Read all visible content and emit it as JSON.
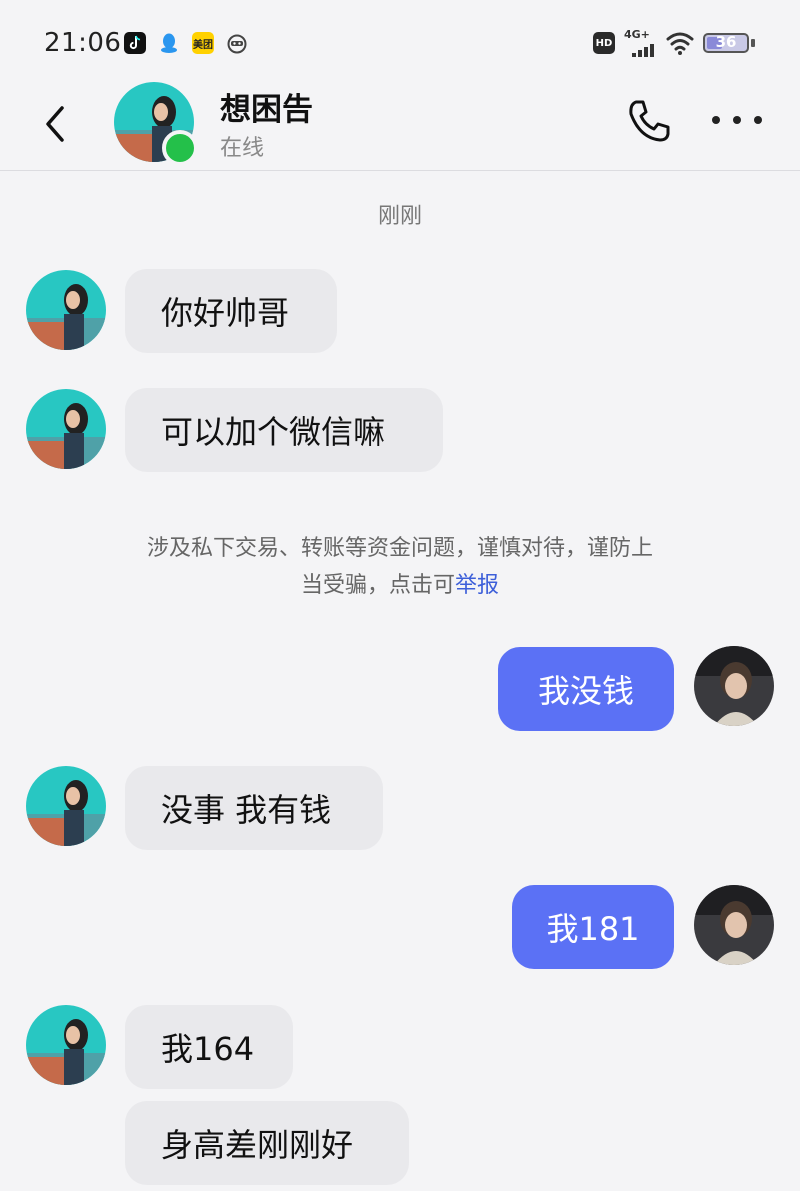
{
  "status_bar": {
    "time": "21:06",
    "apps": [
      {
        "icon": "douyin-icon",
        "color": "#111111"
      },
      {
        "icon": "qq-icon",
        "color": "#2a96ef"
      },
      {
        "icon": "meituan-icon",
        "label": "美团",
        "color": "#ffd100"
      },
      {
        "icon": "bilibili-mascot-icon",
        "color": "#444444"
      }
    ],
    "hd_label": "HD",
    "network_label": "4G+",
    "battery": "36"
  },
  "header": {
    "name": "想困告",
    "status": "在线",
    "online_color": "#24c04a"
  },
  "chat": {
    "timestamp": "刚刚",
    "messages": [
      {
        "side": "in",
        "text": "你好帅哥"
      },
      {
        "side": "in",
        "text": "可以加个微信嘛"
      },
      {
        "side": "out",
        "text": "我没钱"
      },
      {
        "side": "in",
        "text": "没事 我有钱"
      },
      {
        "side": "out",
        "text": "我181"
      },
      {
        "side": "in",
        "text": "我164"
      },
      {
        "side": "in",
        "text": "身高差刚刚好"
      }
    ],
    "notice": {
      "text": "涉及私下交易、转账等资金问题，谨慎对待，谨防上当受骗，点击可",
      "link": "举报"
    }
  },
  "colors": {
    "outgoing_bubble": "#5b71f5",
    "incoming_bubble": "#e9e9ec",
    "link": "#3d5fd9"
  }
}
